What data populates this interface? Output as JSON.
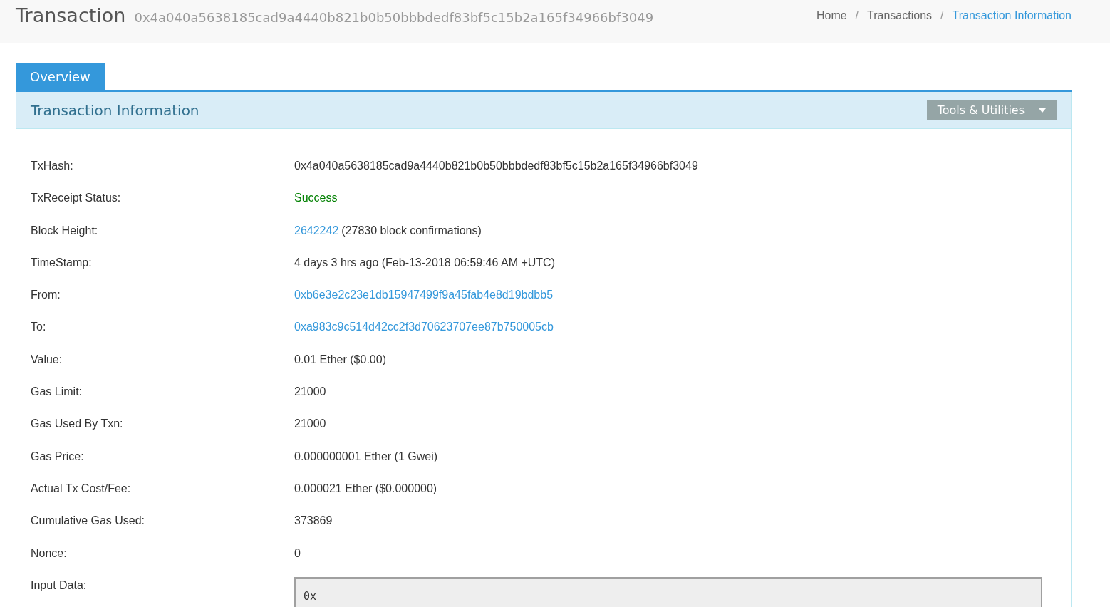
{
  "header": {
    "title": "Transaction",
    "subtitle": "0x4a040a5638185cad9a4440b821b0b50bbbdedf83bf5c15b2a165f34966bf3049"
  },
  "breadcrumb": {
    "separator": "/",
    "items": [
      {
        "label": "Home",
        "selected": false
      },
      {
        "label": "Transactions",
        "selected": false
      },
      {
        "label": "Transaction Information",
        "selected": true
      }
    ]
  },
  "tabs": [
    {
      "label": "Overview",
      "selected": true
    }
  ],
  "panel": {
    "title": "Transaction Information",
    "tools_button": "Tools & Utilities"
  },
  "rows": [
    {
      "label": "TxHash:",
      "value": [
        {
          "kind": "text",
          "text": "0x4a040a5638185cad9a4440b821b0b50bbbdedf83bf5c15b2a165f34966bf3049"
        }
      ]
    },
    {
      "label": "TxReceipt Status:",
      "value": [
        {
          "kind": "status",
          "text": "Success"
        }
      ]
    },
    {
      "label": "Block Height:",
      "value": [
        {
          "kind": "link",
          "text": "2642242"
        },
        {
          "kind": "text",
          "text": "(27830 block confirmations)"
        }
      ]
    },
    {
      "label": "TimeStamp:",
      "value": [
        {
          "kind": "text",
          "text": "4 days 3 hrs ago (Feb-13-2018 06:59:46 AM +UTC)"
        }
      ]
    },
    {
      "label": "From:",
      "value": [
        {
          "kind": "link",
          "text": "0xb6e3e2c23e1db15947499f9a45fab4e8d19bdbb5"
        }
      ]
    },
    {
      "label": "To:",
      "value": [
        {
          "kind": "link",
          "text": "0xa983c9c514d42cc2f3d70623707ee87b750005cb"
        }
      ]
    },
    {
      "label": "Value:",
      "value": [
        {
          "kind": "text",
          "text": "0.01 Ether ($0.00)"
        }
      ]
    },
    {
      "label": "Gas Limit:",
      "value": [
        {
          "kind": "text",
          "text": "21000"
        }
      ]
    },
    {
      "label": "Gas Used By Txn:",
      "value": [
        {
          "kind": "text",
          "text": "21000"
        }
      ]
    },
    {
      "label": "Gas Price:",
      "value": [
        {
          "kind": "text",
          "text": "0.000000001 Ether (1 Gwei)"
        }
      ]
    },
    {
      "label": "Actual Tx Cost/Fee:",
      "value": [
        {
          "kind": "text",
          "text": "0.000021 Ether ($0.000000)"
        }
      ]
    },
    {
      "label": "Cumulative Gas Used:",
      "value": [
        {
          "kind": "text",
          "text": "373869"
        }
      ]
    },
    {
      "label": "Nonce:",
      "value": [
        {
          "kind": "text",
          "text": "0"
        }
      ]
    },
    {
      "label": "Input Data:",
      "value": [
        {
          "kind": "code",
          "text": "0x"
        }
      ]
    }
  ]
}
